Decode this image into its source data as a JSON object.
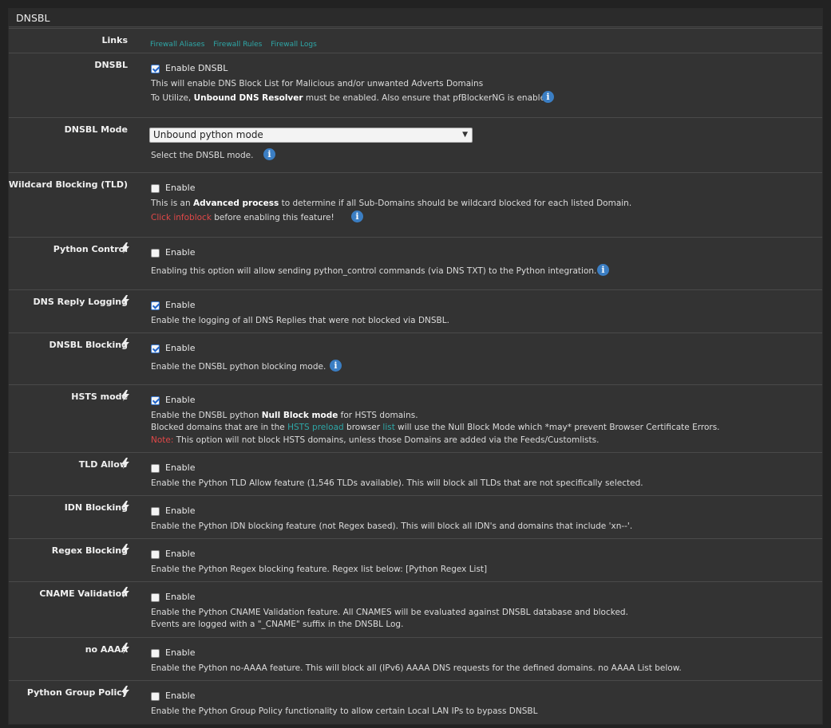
{
  "panel": {
    "title": "DNSBL"
  },
  "links": {
    "label": "Links",
    "items": [
      "Firewall Aliases",
      "Firewall Rules",
      "Firewall Logs"
    ]
  },
  "dnsbl": {
    "label": "DNSBL",
    "checkbox_label": "Enable DNSBL",
    "desc1": "This will enable DNS Block List for Malicious and/or unwanted Adverts Domains",
    "desc2_pre": "To Utilize, ",
    "desc2_bold": "Unbound DNS Resolver",
    "desc2_post": " must be enabled. Also ensure that pfBlockerNG is enabled.",
    "checked": true
  },
  "mode": {
    "label": "DNSBL Mode",
    "selected": "Unbound python mode",
    "desc": "Select the DNSBL mode."
  },
  "wildcard": {
    "label": "Wildcard Blocking (TLD)",
    "checkbox_label": "Enable",
    "desc1_pre": "This is an ",
    "desc1_bold": "Advanced process",
    "desc1_post": " to determine if all Sub-Domains should be wildcard blocked for each listed Domain.",
    "desc2_red": "Click infoblock",
    "desc2_post": " before enabling this feature!",
    "checked": false
  },
  "python_control": {
    "label": "Python Control",
    "checkbox_label": "Enable",
    "desc": "Enabling this option will allow sending python_control commands (via DNS TXT) to the Python integration.",
    "checked": false
  },
  "reply_logging": {
    "label": "DNS Reply Logging",
    "checkbox_label": "Enable",
    "desc": "Enable the logging of all DNS Replies that were not blocked via DNSBL.",
    "checked": true
  },
  "dnsbl_blocking": {
    "label": "DNSBL Blocking",
    "checkbox_label": "Enable",
    "desc": "Enable the DNSBL python blocking mode.",
    "checked": true
  },
  "hsts": {
    "label": "HSTS mode",
    "checkbox_label": "Enable",
    "desc1_pre": "Enable the DNSBL python ",
    "desc1_bold": "Null Block mode",
    "desc1_post": " for HSTS domains.",
    "desc2_a": "Blocked domains that are in the ",
    "desc2_link1": "HSTS preload",
    "desc2_b": " browser ",
    "desc2_link2": "list",
    "desc2_c": " will use the Null Block Mode which *may* prevent Browser Certificate Errors.",
    "desc3_red": "Note:",
    "desc3_post": " This option will not block HSTS domains, unless those Domains are added via the Feeds/Customlists.",
    "checked": true
  },
  "tld_allow": {
    "label": "TLD Allow",
    "checkbox_label": "Enable",
    "desc": "Enable the Python TLD Allow feature (1,546 TLDs available). This will block all TLDs that are not specifically selected.",
    "checked": false
  },
  "idn": {
    "label": "IDN Blocking",
    "checkbox_label": "Enable",
    "desc": "Enable the Python IDN blocking feature (not Regex based). This will block all IDN's and domains that include 'xn--'.",
    "checked": false
  },
  "regex": {
    "label": "Regex Blocking",
    "checkbox_label": "Enable",
    "desc": "Enable the Python Regex blocking feature. Regex list below: [Python Regex List]",
    "checked": false
  },
  "cname": {
    "label": "CNAME Validation",
    "checkbox_label": "Enable",
    "desc1": "Enable the Python CNAME Validation feature. All CNAMES will be evaluated against DNSBL database and blocked.",
    "desc2": "Events are logged with a \"_CNAME\" suffix in the DNSBL Log.",
    "checked": false
  },
  "noaaaa": {
    "label": "no AAAA",
    "checkbox_label": "Enable",
    "desc": "Enable the Python no-AAAA feature. This will block all (IPv6) AAAA DNS requests for the defined domains. no AAAA List below.",
    "checked": false
  },
  "group_policy": {
    "label": "Python Group Policy",
    "checkbox_label": "Enable",
    "desc": "Enable the Python Group Policy functionality to allow certain Local LAN IPs to bypass DNSBL",
    "checked": false
  },
  "colors": {
    "accent": "#3b7ec3",
    "link": "#2ea7a7",
    "warning": "#e04848",
    "background": "#333333"
  }
}
